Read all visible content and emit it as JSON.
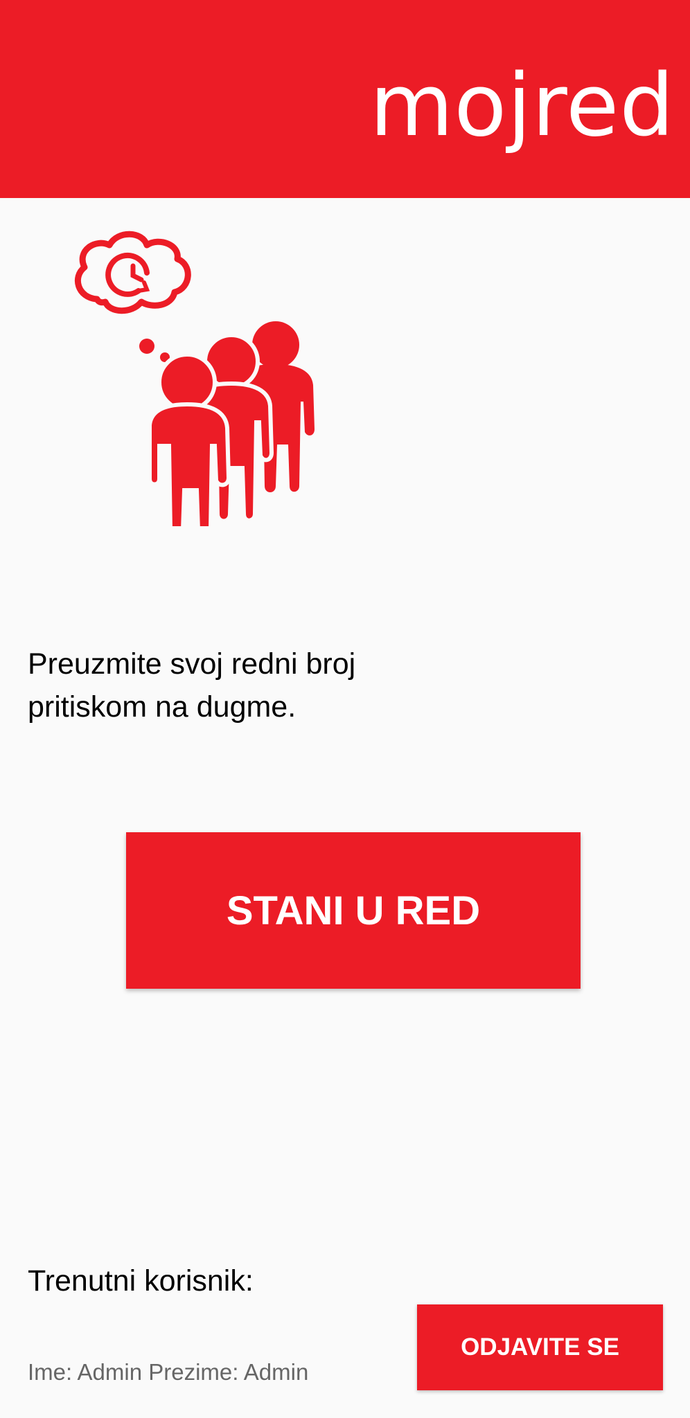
{
  "header": {
    "logo_text": "mojred",
    "background_color": "#ec1c26"
  },
  "illustration": {
    "icon": "queue-people-thinking-icon",
    "color": "#ec1c26"
  },
  "main": {
    "instruction_text": "Preuzmite svoj redni broj\n pritiskom na dugme.",
    "queue_button_label": "STANI U RED"
  },
  "footer": {
    "current_user_label": "Trenutni korisnik:",
    "user_names": "Ime: Admin Prezime: Admin",
    "logout_button_label": "ODJAVITE SE"
  }
}
